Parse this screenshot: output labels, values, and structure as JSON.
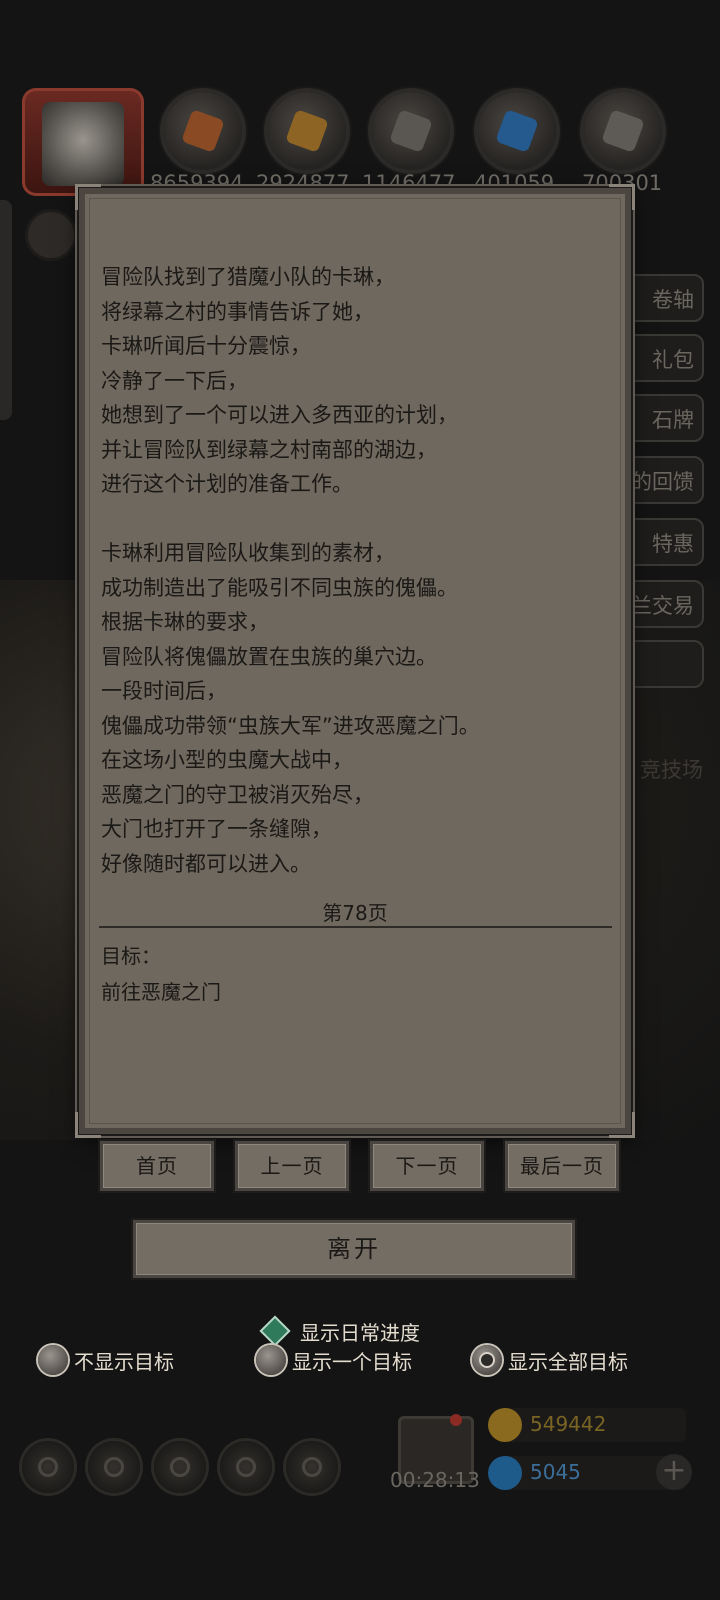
{
  "background": {
    "resources": [
      {
        "icon": "ore-orange-icon",
        "value": "8659394",
        "color": "#a85a2a"
      },
      {
        "icon": "wood-plank-icon",
        "value": "2924877",
        "color": "#b07a2a"
      },
      {
        "icon": "iron-bar-icon",
        "value": "1146477",
        "color": "#7a7672"
      },
      {
        "icon": "blue-crystal-icon",
        "value": "401059",
        "color": "#2a6aa8"
      },
      {
        "icon": "silver-bar-icon",
        "value": "700301",
        "color": "#8a8782"
      }
    ],
    "side_tabs": [
      "卷轴",
      "礼包",
      "石牌",
      "的回馈",
      "特惠",
      "兰交易"
    ],
    "arena_label": "竞技场",
    "timer": "00:28:13",
    "gold": "549442",
    "gems": "5045"
  },
  "dialog": {
    "story_lines": [
      "冒险队找到了猎魔小队的卡琳，",
      "将绿幕之村的事情告诉了她，",
      "卡琳听闻后十分震惊，",
      "冷静了一下后，",
      "她想到了一个可以进入多西亚的计划，",
      "并让冒险队到绿幕之村南部的湖边，",
      "进行这个计划的准备工作。",
      "",
      "卡琳利用冒险队收集到的素材，",
      "成功制造出了能吸引不同虫族的傀儡。",
      "根据卡琳的要求，",
      "冒险队将傀儡放置在虫族的巢穴边。",
      "一段时间后，",
      "傀儡成功带领“虫族大军”进攻恶魔之门。",
      "在这场小型的虫魔大战中，",
      "恶魔之门的守卫被消灭殆尽，",
      "大门也打开了一条缝隙，",
      "好像随时都可以进入。"
    ],
    "page": "第78页",
    "goal_title": "目标：",
    "goal_text": "前往恶魔之门"
  },
  "nav": {
    "first": "首页",
    "prev": "上一页",
    "next": "下一页",
    "last": "最后一页",
    "leave": "离开"
  },
  "options": {
    "daily_progress": "显示日常进度",
    "hide_goals": "不显示目标",
    "one_goal": "显示一个目标",
    "all_goals": "显示全部目标",
    "selected": "all_goals"
  }
}
